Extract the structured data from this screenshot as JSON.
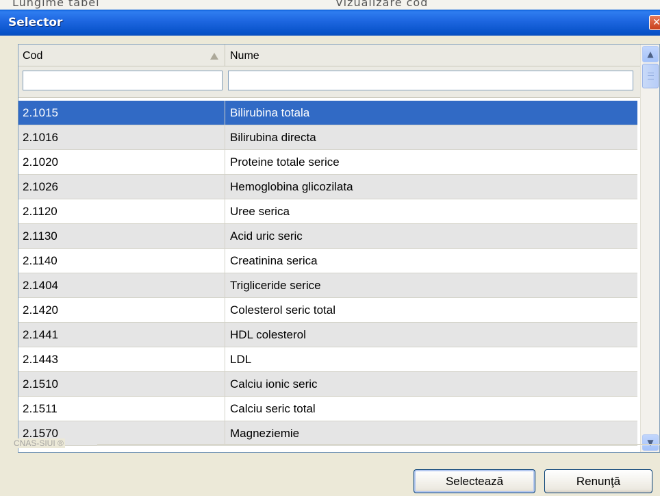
{
  "background_window": {
    "partial_text_left": "Lungime tabel",
    "partial_text_right": "Vizualizare cod"
  },
  "window": {
    "title": "Selector",
    "close_label": "✕"
  },
  "grid": {
    "columns": [
      {
        "label": "Cod"
      },
      {
        "label": "Nume"
      }
    ],
    "filter": {
      "cod_value": "",
      "nume_value": ""
    },
    "selected_index": 0,
    "rows": [
      {
        "cod": "2.1015",
        "nume": "Bilirubina totala"
      },
      {
        "cod": "2.1016",
        "nume": "Bilirubina directa"
      },
      {
        "cod": "2.1020",
        "nume": "Proteine totale serice"
      },
      {
        "cod": "2.1026",
        "nume": "Hemoglobina glicozilata"
      },
      {
        "cod": "2.1120",
        "nume": "Uree serica"
      },
      {
        "cod": "2.1130",
        "nume": "Acid uric seric"
      },
      {
        "cod": "2.1140",
        "nume": "Creatinina serica"
      },
      {
        "cod": "2.1404",
        "nume": "Trigliceride serice"
      },
      {
        "cod": "2.1420",
        "nume": "Colesterol seric total"
      },
      {
        "cod": "2.1441",
        "nume": "HDL colesterol"
      },
      {
        "cod": "2.1443",
        "nume": "LDL"
      },
      {
        "cod": "2.1510",
        "nume": "Calciu ionic seric"
      },
      {
        "cod": "2.1511",
        "nume": "Calciu seric total"
      },
      {
        "cod": "2.1570",
        "nume": "Magneziemie"
      }
    ]
  },
  "footer": {
    "brand": "CNAS-SIUI ®"
  },
  "buttons": {
    "select_label": "Selectează",
    "cancel_label": "Renunţă"
  },
  "colors": {
    "selection": "#316ac5",
    "titlebar": "#0a5fd8",
    "alt_row": "#e5e5e5"
  },
  "icons": {
    "sort": "sort-ascending-icon",
    "scroll_up": "chevron-up-icon",
    "scroll_down": "chevron-down-icon"
  }
}
